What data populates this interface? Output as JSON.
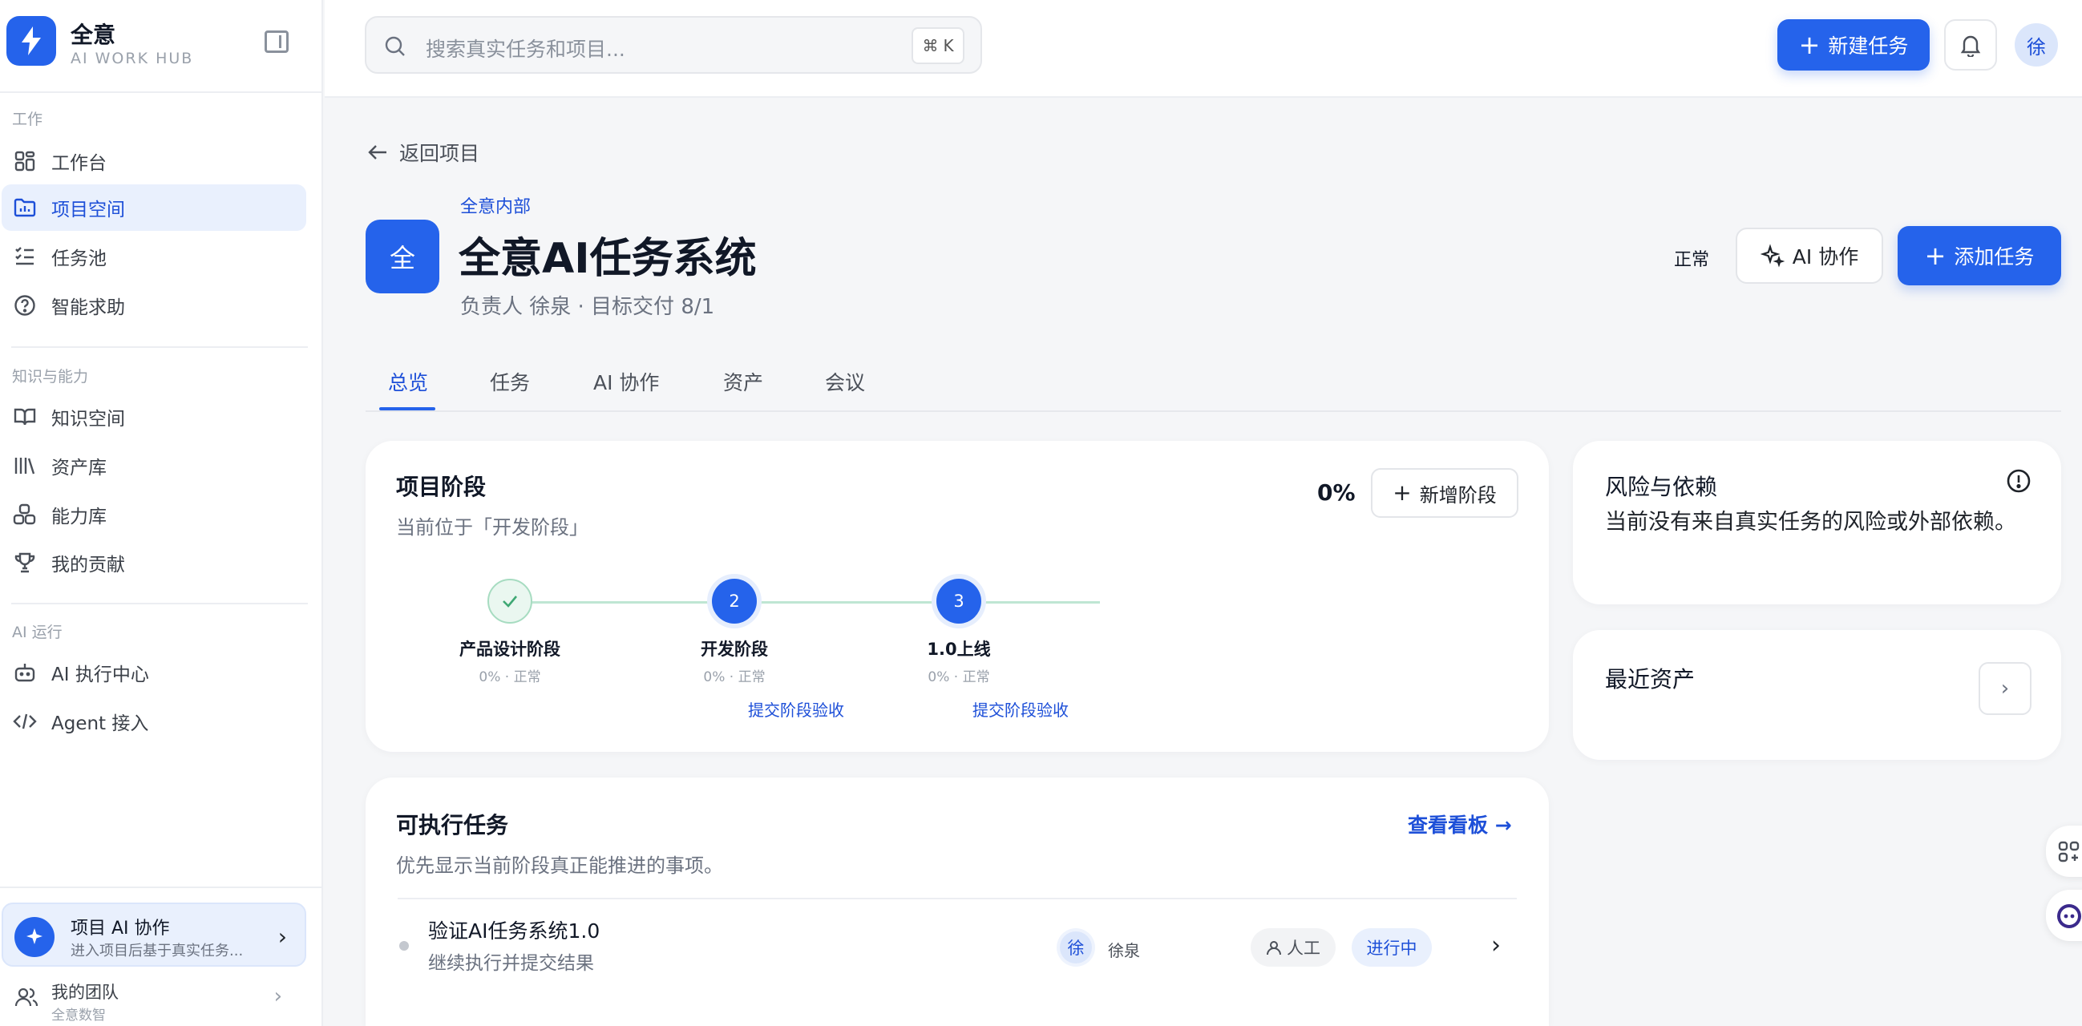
{
  "brand": {
    "name": "全意",
    "subtitle": "AI WORK HUB"
  },
  "sidebar": {
    "sections": [
      {
        "label": "工作",
        "items": [
          {
            "label": "工作台",
            "icon": "grid-icon"
          },
          {
            "label": "项目空间",
            "icon": "folder-chart-icon",
            "active": true
          },
          {
            "label": "任务池",
            "icon": "list-check-icon"
          },
          {
            "label": "智能求助",
            "icon": "help-circle-icon"
          }
        ]
      },
      {
        "label": "知识与能力",
        "items": [
          {
            "label": "知识空间",
            "icon": "book-open-icon"
          },
          {
            "label": "资产库",
            "icon": "library-icon"
          },
          {
            "label": "能力库",
            "icon": "blocks-icon"
          },
          {
            "label": "我的贡献",
            "icon": "trophy-icon"
          }
        ]
      },
      {
        "label": "AI 运行",
        "items": [
          {
            "label": "AI 执行中心",
            "icon": "bot-icon"
          },
          {
            "label": "Agent 接入",
            "icon": "code-icon"
          }
        ]
      }
    ],
    "ai_card": {
      "title": "项目 AI 协作",
      "subtitle": "进入项目后基于真实任务..."
    },
    "team": {
      "title": "我的团队",
      "subtitle": "全意数智"
    }
  },
  "topbar": {
    "search_placeholder": "搜索真实任务和项目...",
    "shortcut_symbol": "⌘",
    "shortcut_key": "K",
    "new_task": "新建任务",
    "avatar": "徐"
  },
  "project": {
    "back": "返回项目",
    "logo": "全",
    "org": "全意内部",
    "title": "全意AI任务系统",
    "meta": "负责人 徐泉 · 目标交付 8/1",
    "status": "正常",
    "ai_button": "AI 协作",
    "add_task": "添加任务"
  },
  "tabs": [
    "总览",
    "任务",
    "AI 协作",
    "资产",
    "会议"
  ],
  "phases": {
    "title": "项目阶段",
    "subtitle": "当前位于「开发阶段」",
    "percent": "0%",
    "add_button": "新增阶段",
    "steps": [
      {
        "num": "",
        "name": "产品设计阶段",
        "meta": "0% · 正常",
        "link": ""
      },
      {
        "num": "2",
        "name": "开发阶段",
        "meta": "0% · 正常",
        "link": "提交阶段验收"
      },
      {
        "num": "3",
        "name": "1.0上线",
        "meta": "0% · 正常",
        "link": "提交阶段验收"
      }
    ]
  },
  "risk": {
    "title": "风险与依赖",
    "text": "当前没有来自真实任务的风险或外部依赖。"
  },
  "assets": {
    "title": "最近资产"
  },
  "tasks": {
    "title": "可执行任务",
    "subtitle": "优先显示当前阶段真正能推进的事项。",
    "kanban_link": "查看看板",
    "items": [
      {
        "name": "验证AI任务系统1.0",
        "sub": "继续执行并提交结果",
        "owner_avatar": "徐",
        "owner": "徐泉",
        "type": "人工",
        "status": "进行中"
      }
    ]
  },
  "colors": {
    "primary": "#2563eb",
    "active_bg": "#e9f0fd",
    "step_line": "#bfe6d3"
  }
}
